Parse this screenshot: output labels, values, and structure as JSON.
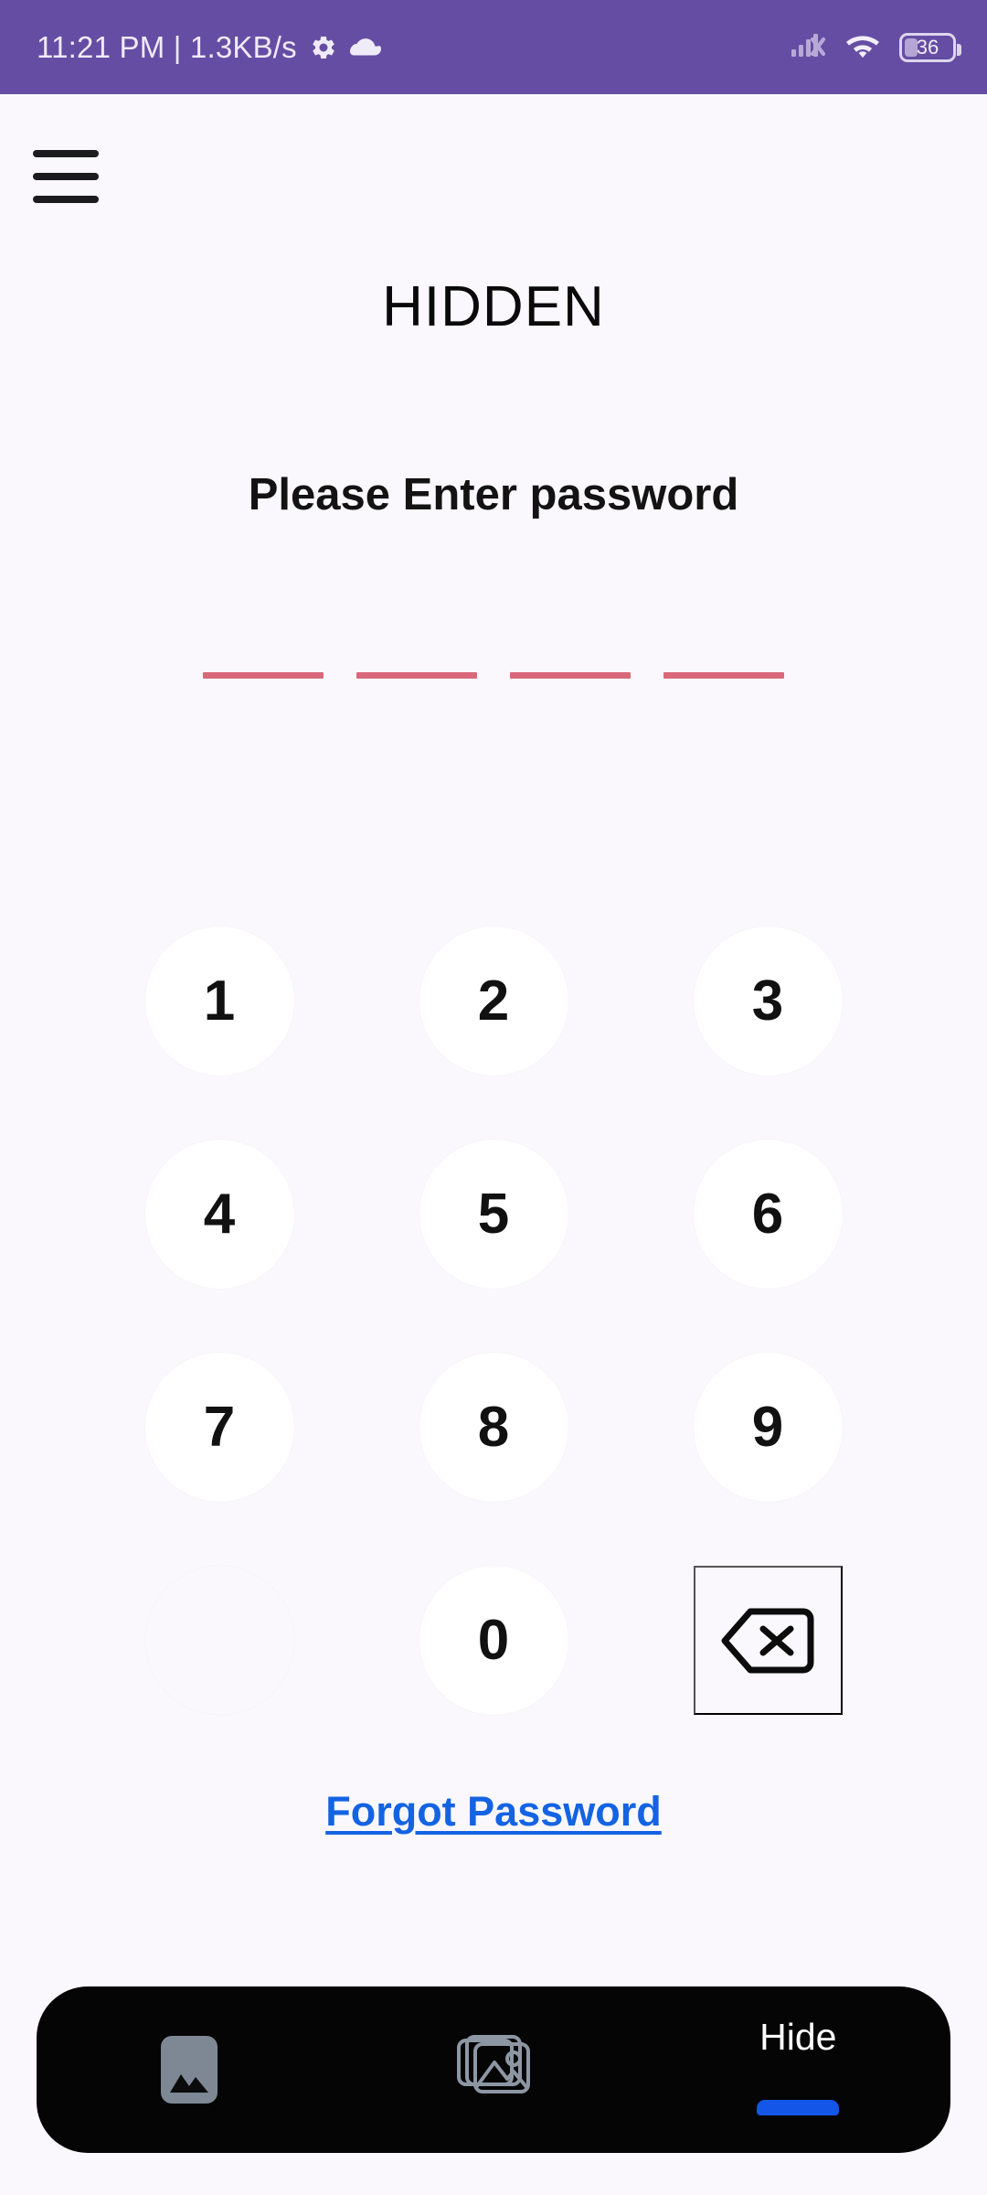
{
  "status_bar": {
    "clock_and_net": "11:21 PM | 1.3KB/s",
    "gear_icon": "gear-icon",
    "cloud_icon": "cloud-icon",
    "signal_icon": "signal-no-sim-icon",
    "wifi_icon": "wifi-icon",
    "battery_level": "36",
    "background_color": "#654da4"
  },
  "header": {
    "menu_icon": "hamburger-menu-icon",
    "app_title": "HIDDEN"
  },
  "main": {
    "prompt": "Please Enter password",
    "pin": {
      "length": 4,
      "entered": 0,
      "dash_color": "#d9697a"
    },
    "keypad": {
      "keys": [
        {
          "label": "1",
          "type": "digit"
        },
        {
          "label": "2",
          "type": "digit"
        },
        {
          "label": "3",
          "type": "digit"
        },
        {
          "label": "4",
          "type": "digit"
        },
        {
          "label": "5",
          "type": "digit"
        },
        {
          "label": "6",
          "type": "digit"
        },
        {
          "label": "7",
          "type": "digit"
        },
        {
          "label": "8",
          "type": "digit"
        },
        {
          "label": "9",
          "type": "digit"
        },
        {
          "label": "",
          "type": "blank"
        },
        {
          "label": "0",
          "type": "digit"
        },
        {
          "label": "backspace-icon",
          "type": "backspace"
        }
      ]
    },
    "forgot_password_label": "Forgot Password",
    "forgot_password_color": "#1463e3"
  },
  "bottom_bar": {
    "background_color": "#050505",
    "wallpaper_icon": "image-icon",
    "gallery_icon": "photo-stack-icon",
    "hide_label": "Hide",
    "indicator_color": "#1356e8"
  }
}
